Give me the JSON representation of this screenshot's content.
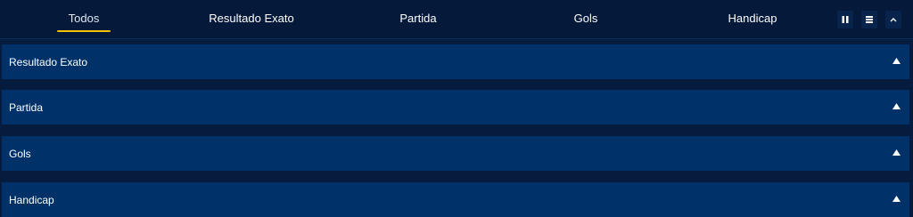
{
  "tabs": [
    {
      "label": "Todos"
    },
    {
      "label": "Resultado Exato"
    },
    {
      "label": "Partida"
    },
    {
      "label": "Gols"
    },
    {
      "label": "Handicap"
    }
  ],
  "active_tab": "Todos",
  "controls": [
    "pause-columns-icon",
    "list-view-icon",
    "collapse-chevron-icon"
  ],
  "sections": [
    {
      "label": "Resultado Exato"
    },
    {
      "label": "Partida"
    },
    {
      "label": "Gols"
    },
    {
      "label": "Handicap"
    }
  ],
  "colors": {
    "background": "#061c3f",
    "topbar": "#051a3a",
    "section": "#003269",
    "accent": "#f2c200"
  }
}
